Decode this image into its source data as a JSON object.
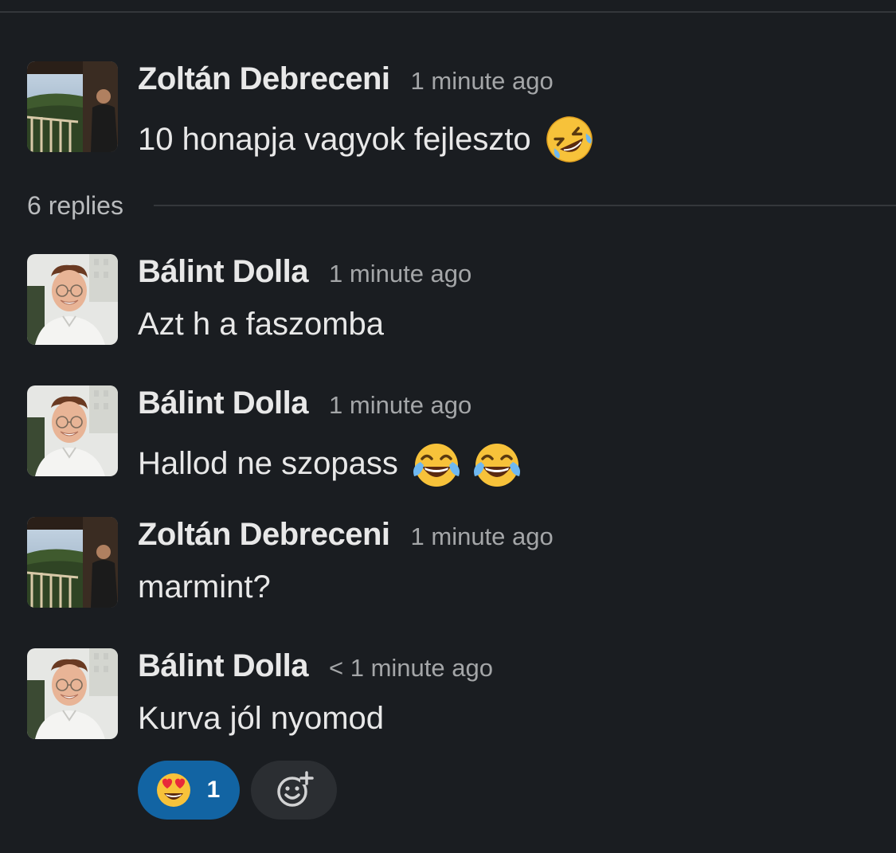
{
  "thread": {
    "parent": {
      "author": "Zoltán Debreceni",
      "timestamp": "1 minute ago",
      "text": "10 honapja vagyok fejleszto",
      "emojis": [
        "rolling-on-floor-laughing"
      ]
    },
    "replies_label": "6 replies",
    "replies": [
      {
        "author": "Bálint Dolla",
        "timestamp": "1 minute ago",
        "text": "Azt h a faszomba",
        "emojis": []
      },
      {
        "author": "Bálint Dolla",
        "timestamp": "1 minute ago",
        "text": "Hallod ne szopass",
        "emojis": [
          "face-with-tears-of-joy",
          "face-with-tears-of-joy"
        ]
      },
      {
        "author": "Zoltán Debreceni",
        "timestamp": "1 minute ago",
        "text": "marmint?",
        "emojis": []
      },
      {
        "author": "Bálint Dolla",
        "timestamp": "< 1 minute ago",
        "text": "Kurva jól nyomod",
        "emojis": [],
        "reactions": [
          {
            "emoji": "heart-eyes",
            "count": "1",
            "selected": true
          }
        ]
      }
    ]
  },
  "colors": {
    "background": "#1a1d21",
    "reaction_selected": "#1264a3",
    "reaction_add_bg": "#2b2e32",
    "text_primary": "#e8e8e8",
    "text_muted": "#a4a6a8"
  },
  "icons": {
    "add_reaction": "add-reaction-icon"
  }
}
